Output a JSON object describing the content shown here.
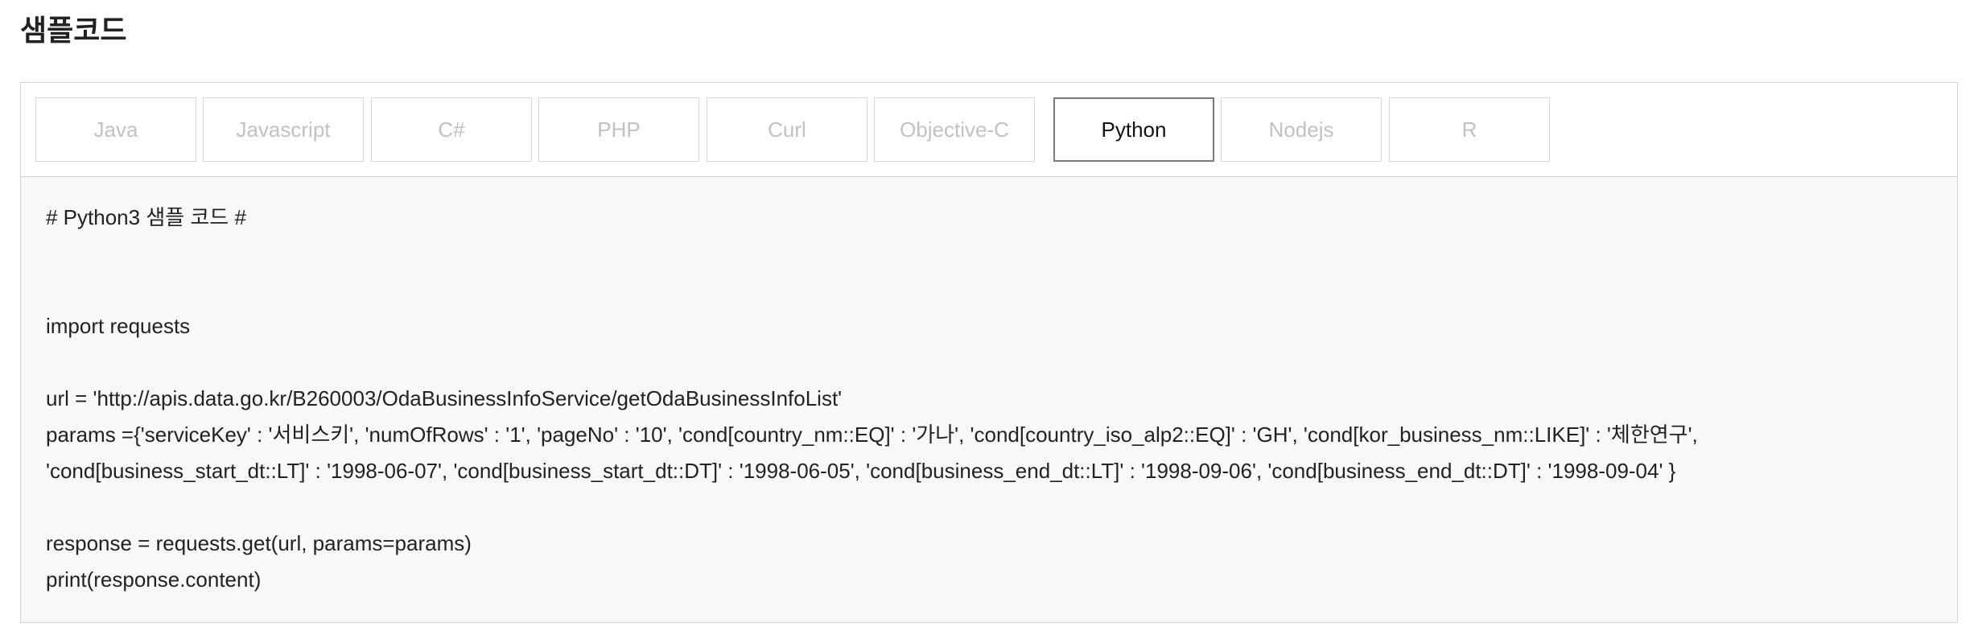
{
  "section": {
    "title": "샘플코드"
  },
  "tabs": [
    {
      "label": "Java",
      "active": false
    },
    {
      "label": "Javascript",
      "active": false
    },
    {
      "label": "C#",
      "active": false
    },
    {
      "label": "PHP",
      "active": false
    },
    {
      "label": "Curl",
      "active": false
    },
    {
      "label": "Objective-C",
      "active": false
    },
    {
      "label": "Python",
      "active": true
    },
    {
      "label": "Nodejs",
      "active": false
    },
    {
      "label": "R",
      "active": false
    }
  ],
  "code": {
    "lines": [
      "# Python3 샘플 코드 #",
      "",
      "",
      "import requests",
      "",
      "url = 'http://apis.data.go.kr/B260003/OdaBusinessInfoService/getOdaBusinessInfoList'",
      "params ={'serviceKey' : '서비스키', 'numOfRows' : '1', 'pageNo' : '10', 'cond[country_nm::EQ]' : '가나', 'cond[country_iso_alp2::EQ]' : 'GH', 'cond[kor_business_nm::LIKE]' : '체한연구',",
      "'cond[business_start_dt::LT]' : '1998-06-07', 'cond[business_start_dt::DT]' : '1998-06-05', 'cond[business_end_dt::LT]' : '1998-09-06', 'cond[business_end_dt::DT]' : '1998-09-04' }",
      "",
      "response = requests.get(url, params=params)",
      "print(response.content)"
    ]
  }
}
